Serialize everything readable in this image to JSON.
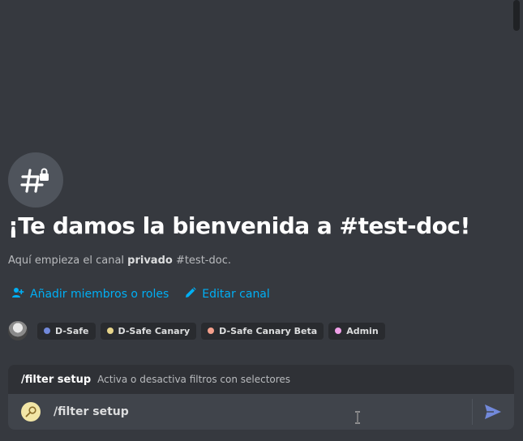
{
  "welcome": {
    "title": "¡Te damos la bienvenida a #test-doc!",
    "subtitle_before": "Aquí empieza el canal ",
    "subtitle_bold": "privado",
    "subtitle_after": " #test-doc."
  },
  "actions": {
    "add_members_label": "Añadir miembros o roles",
    "edit_channel_label": "Editar canal"
  },
  "roles": [
    {
      "label": "D-Safe",
      "color": "#7289da"
    },
    {
      "label": "D-Safe Canary",
      "color": "#e6d48a"
    },
    {
      "label": "D-Safe Canary Beta",
      "color": "#f4a08c"
    },
    {
      "label": "Admin",
      "color": "#f0a0e8"
    }
  ],
  "autocomplete": {
    "command": "/filter setup",
    "description": "Activa o desactiva filtros con selectores"
  },
  "composer": {
    "value": "/filter setup"
  },
  "icons": {
    "channel": "private-channel-icon",
    "add_members": "add-member-icon",
    "edit": "pencil-icon",
    "send": "send-icon",
    "cursor": "text-cursor-icon"
  },
  "colors": {
    "background": "#36393f",
    "link": "#00aff4",
    "send": "#7289da"
  }
}
